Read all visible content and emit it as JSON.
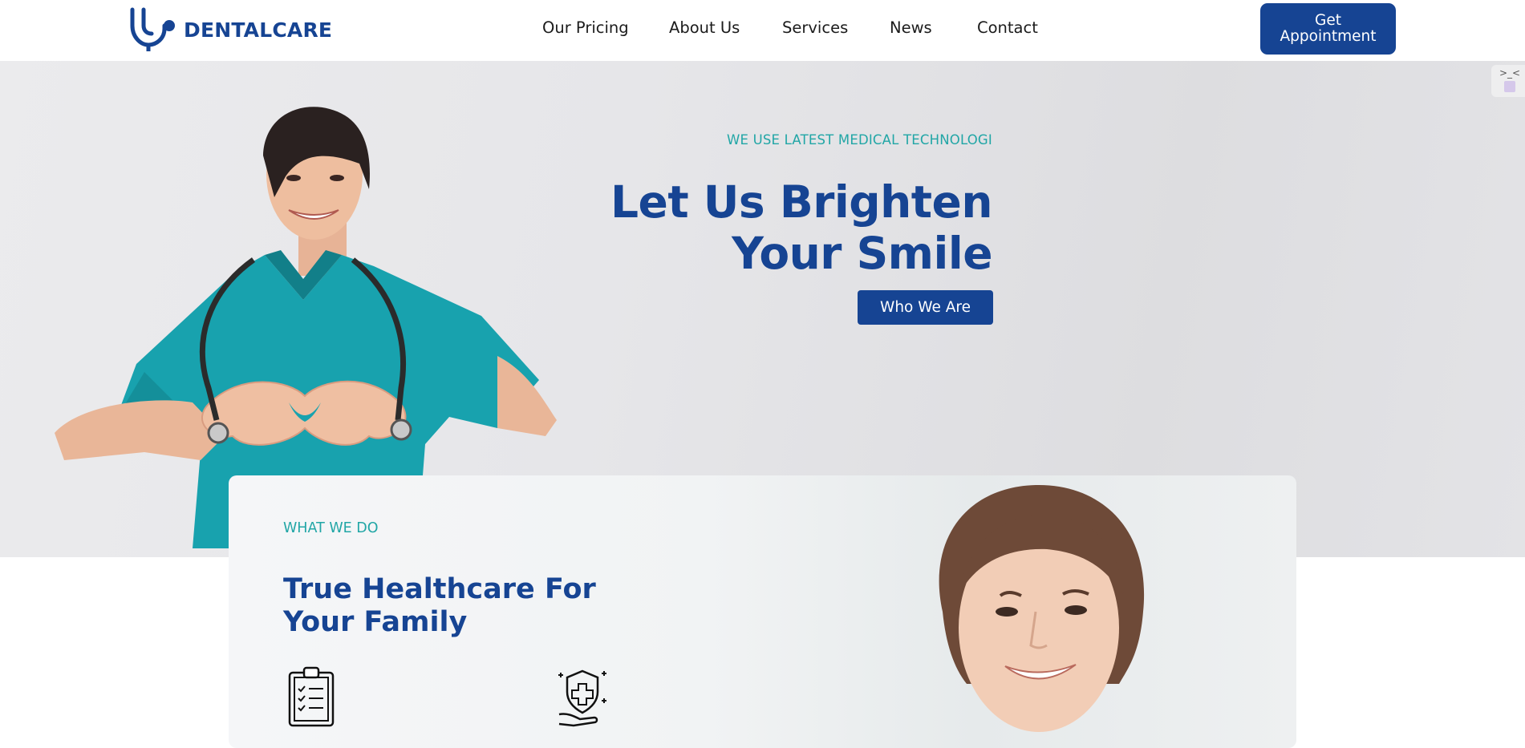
{
  "brand": {
    "name": "DENTALCARE",
    "logo_icon": "stethoscope-icon",
    "color": "#164493"
  },
  "nav": {
    "items": [
      "Our Pricing",
      "About Us",
      "Services",
      "News",
      "Contact"
    ]
  },
  "header": {
    "cta_label": "Get Appointment"
  },
  "hero": {
    "kicker": "WE USE LATEST MEDICAL TECHNOLOGI",
    "title_line1": "Let Us Brighten",
    "title_line2": "Your Smile",
    "button_label": "Who We Are",
    "accent_color": "#21a6a6",
    "image": "nurse-heart-hands-photo"
  },
  "side_widget": {
    "glyph": ">_<"
  },
  "what_we_do": {
    "kicker": "WHAT WE DO",
    "title_line1": "True Healthcare For",
    "title_line2": "Your Family",
    "features": [
      {
        "icon": "clipboard-checklist-icon"
      },
      {
        "icon": "medical-shield-hand-icon"
      }
    ],
    "image": "doctor-portrait-photo"
  }
}
